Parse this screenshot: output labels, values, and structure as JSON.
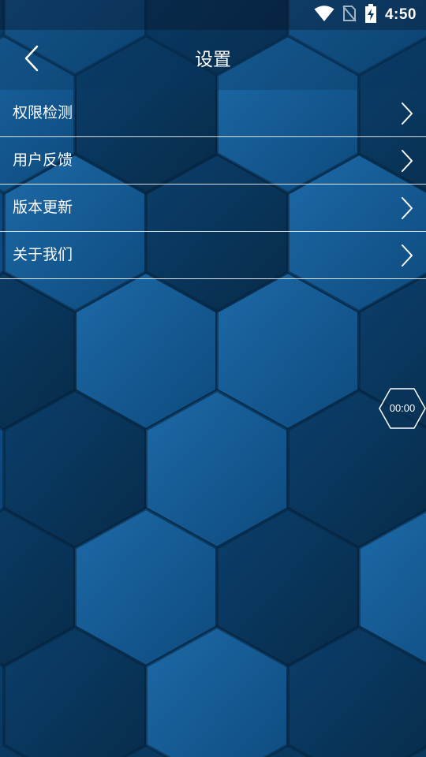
{
  "status_bar": {
    "time": "4:50",
    "icons": [
      "wifi-icon",
      "no-sim-icon",
      "battery-charging-icon"
    ]
  },
  "header": {
    "title": "设置",
    "back_icon": "chevron-left-icon"
  },
  "menu": {
    "items": [
      {
        "label": "权限检测",
        "icon": "chevron-right-icon"
      },
      {
        "label": "用户反馈",
        "icon": "chevron-right-icon"
      },
      {
        "label": "版本更新",
        "icon": "chevron-right-icon"
      },
      {
        "label": "关于我们",
        "icon": "chevron-right-icon"
      }
    ]
  },
  "timer": {
    "text": "00:00"
  },
  "colors": {
    "background": "#0d4c7e",
    "text": "#ffffff",
    "divider": "#ffffff"
  }
}
